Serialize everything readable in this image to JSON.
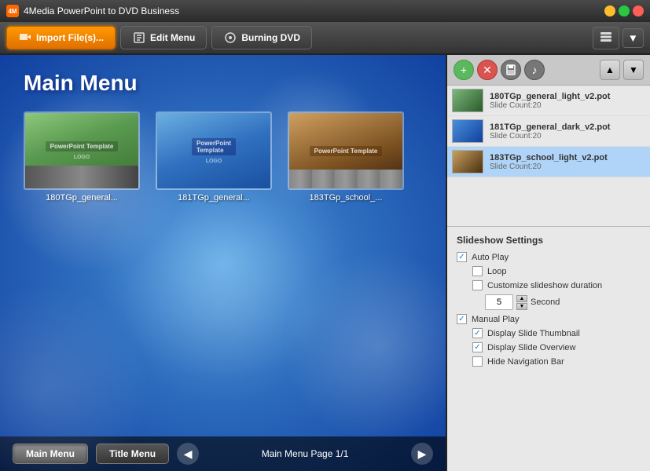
{
  "titleBar": {
    "title": "4Media PowerPoint to DVD Business",
    "icon": "4M"
  },
  "toolbar": {
    "importBtn": "Import File(s)...",
    "editMenuBtn": "Edit Menu",
    "burningDvdBtn": "Burning DVD"
  },
  "preview": {
    "title": "Main Menu",
    "thumbnails": [
      {
        "id": 1,
        "label": "180TGp_general...",
        "type": "green"
      },
      {
        "id": 2,
        "label": "181TGp_general...",
        "type": "blue"
      },
      {
        "id": 3,
        "label": "183TGp_school_...",
        "type": "school"
      }
    ],
    "pageLabel": "Main Menu Page 1/1",
    "mainMenuBtn": "Main Menu",
    "titleMenuBtn": "Title Menu"
  },
  "fileList": {
    "items": [
      {
        "name": "180TGp_general_light_v2.pot",
        "count": "Slide Count:20",
        "type": "green"
      },
      {
        "name": "181TGp_general_dark_v2.pot",
        "count": "Slide Count:20",
        "type": "blue"
      },
      {
        "name": "183TGp_school_light_v2.pot",
        "count": "Slide Count:20",
        "type": "school"
      }
    ]
  },
  "settings": {
    "title": "Slideshow Settings",
    "autoPlay": {
      "label": "Auto Play",
      "checked": true
    },
    "loop": {
      "label": "Loop",
      "checked": false
    },
    "customizeDuration": {
      "label": "Customize slideshow duration",
      "checked": false
    },
    "durationValue": "5",
    "durationUnit": "Second",
    "manualPlay": {
      "label": "Manual Play",
      "checked": true
    },
    "displayThumbnail": {
      "label": "Display Slide Thumbnail",
      "checked": true
    },
    "displayOverview": {
      "label": "Display Slide Overview",
      "checked": true
    },
    "hideNavBar": {
      "label": "Hide Navigation Bar",
      "checked": false
    }
  }
}
